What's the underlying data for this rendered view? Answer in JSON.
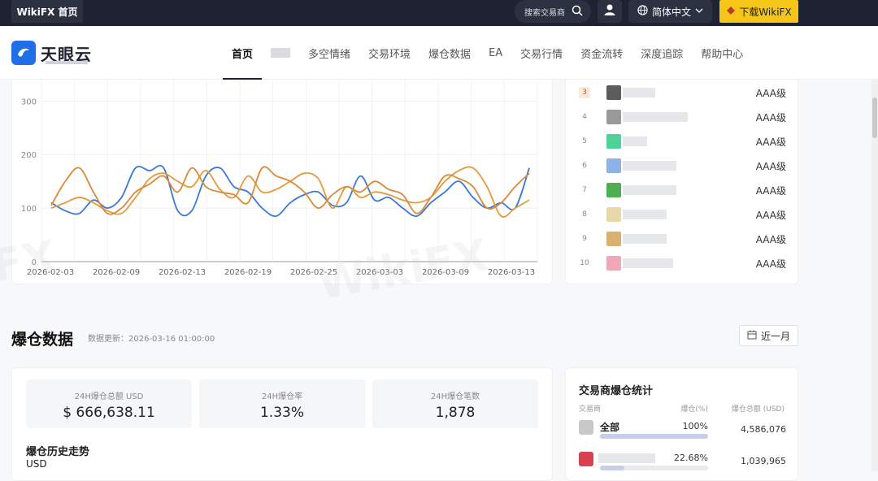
{
  "topbar": {
    "home_label": "WikiFX 首页",
    "search_placeholder": "搜索交易商",
    "language": "简体中文",
    "download_label": "下载WikiFX"
  },
  "header": {
    "logo_text": "天眼云",
    "nav": [
      {
        "label": "首页",
        "active": true
      },
      {
        "label": "",
        "blurred": true
      },
      {
        "label": "多空情绪"
      },
      {
        "label": "交易环境"
      },
      {
        "label": "爆仓数据"
      },
      {
        "label": "EA"
      },
      {
        "label": "交易行情"
      },
      {
        "label": "资金流转"
      },
      {
        "label": "深度追踪"
      },
      {
        "label": "帮助中心"
      }
    ]
  },
  "chart_data": {
    "type": "line",
    "x": [
      "2026-02-03",
      "2026-02-09",
      "2026-02-13",
      "2026-02-19",
      "2026-02-25",
      "2026-03-03",
      "2026-03-09",
      "2026-03-13"
    ],
    "yticks": [
      0,
      100,
      200,
      300
    ],
    "ylim": [
      0,
      340
    ],
    "grid": true,
    "series": [
      {
        "color": "#3b78d8",
        "values": [
          110,
          95,
          90,
          115,
          100,
          120,
          175,
          170,
          175,
          95,
          95,
          160,
          175,
          140,
          130,
          100,
          85,
          110,
          125,
          130,
          105,
          110,
          160,
          115,
          120,
          100,
          85,
          110,
          130,
          150,
          120,
          100,
          110,
          100,
          175
        ]
      },
      {
        "color": "#e69a3a",
        "values": [
          100,
          110,
          120,
          110,
          95,
          90,
          120,
          155,
          165,
          150,
          140,
          170,
          135,
          120,
          160,
          130,
          135,
          150,
          165,
          155,
          100,
          140,
          120,
          130,
          125,
          115,
          110,
          120,
          150,
          170,
          175,
          140,
          85,
          100,
          115
        ]
      },
      {
        "color": "#d98a3a",
        "values": [
          105,
          150,
          175,
          130,
          90,
          100,
          130,
          145,
          160,
          130,
          175,
          140,
          130,
          125,
          110,
          175,
          160,
          150,
          130,
          100,
          125,
          140,
          130,
          150,
          135,
          125,
          90,
          120,
          160,
          155,
          140,
          100,
          110,
          140,
          165
        ]
      }
    ]
  },
  "rankings": [
    {
      "rank": "3",
      "grade": "AAA级",
      "logo_color": "#5c5c5c",
      "name_width": 40
    },
    {
      "rank": "4",
      "grade": "AAA级",
      "logo_color": "#9a9a9a",
      "name_width": 80
    },
    {
      "rank": "5",
      "grade": "AAA级",
      "logo_color": "#4fd29a",
      "name_width": 30
    },
    {
      "rank": "6",
      "grade": "AAA级",
      "logo_color": "#8fb2e6",
      "name_width": 66
    },
    {
      "rank": "7",
      "grade": "AAA级",
      "logo_color": "#4caf50",
      "name_width": 66
    },
    {
      "rank": "8",
      "grade": "AAA级",
      "logo_color": "#e8d7a8",
      "name_width": 54
    },
    {
      "rank": "9",
      "grade": "AAA级",
      "logo_color": "#d9b070",
      "name_width": 54
    },
    {
      "rank": "10",
      "grade": "AAA级",
      "logo_color": "#f0a8b8",
      "name_width": 62
    }
  ],
  "liquidation": {
    "title": "爆仓数据",
    "update": "数据更新：2026-03-16 01:00:00",
    "range_button": "近一月",
    "stats": [
      {
        "label": "24H爆仓总额 USD",
        "value": "$ 666,638.11"
      },
      {
        "label": "24H爆仓率",
        "value": "1.33%"
      },
      {
        "label": "24H爆仓笔数",
        "value": "1,878"
      }
    ],
    "history_title": "爆仓历史走势",
    "history_unit": "USD"
  },
  "broker_stats": {
    "title": "交易商爆仓统计",
    "col_broker": "交易商",
    "col_pct": "爆仓(%)",
    "col_amount": "爆仓总额 (USD)",
    "rows": [
      {
        "name": "全部",
        "pct": "100%",
        "pct_value": 100,
        "amount": "4,586,076",
        "logo_color": "#c8c8c8"
      },
      {
        "name": "",
        "pct": "22.68%",
        "pct_value": 22.68,
        "amount": "1,039,965",
        "logo_color": "#d94050"
      }
    ]
  }
}
